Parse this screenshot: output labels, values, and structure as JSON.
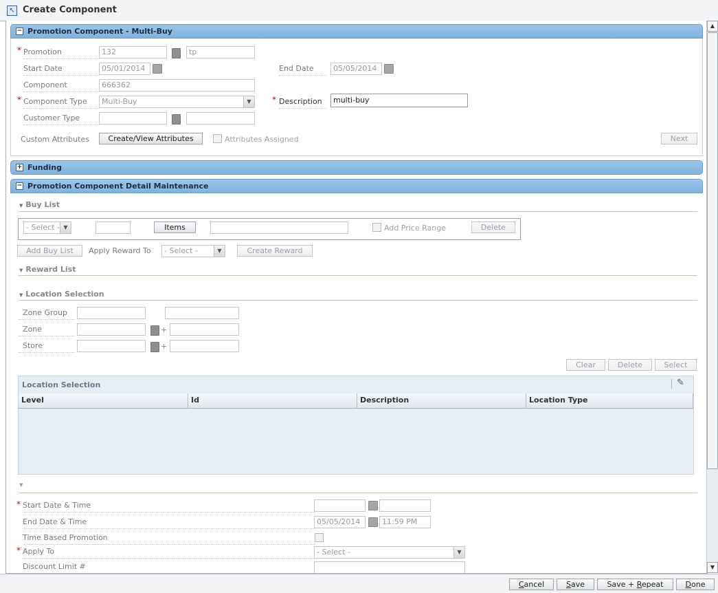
{
  "window": {
    "title": "Create Component"
  },
  "section_main": {
    "title": "Promotion Component - Multi-Buy",
    "promotion_label": "Promotion",
    "promotion_id": "132",
    "promotion_desc": "tp",
    "start_date_label": "Start Date",
    "start_date": "05/01/2014",
    "end_date_label": "End Date",
    "end_date": "05/05/2014",
    "component_label": "Component",
    "component": "666362",
    "component_type_label": "Component Type",
    "component_type": "Multi-Buy",
    "description_label": "Description",
    "description": "multi-buy",
    "customer_type_label": "Customer Type",
    "custom_attributes_label": "Custom Attributes",
    "create_view_attributes": "Create/View Attributes",
    "attributes_assigned": "Attributes Assigned",
    "next": "Next"
  },
  "section_funding": {
    "title": "Funding"
  },
  "section_detail": {
    "title": "Promotion Component Detail Maintenance",
    "buy_list": {
      "title": "Buy List",
      "select_placeholder": "- Select -",
      "items": "Items",
      "add_price_range": "Add Price Range",
      "delete": "Delete",
      "add_buy_list": "Add Buy List",
      "apply_reward_to_label": "Apply Reward To",
      "apply_reward_select": "- Select -",
      "create_reward": "Create Reward"
    },
    "reward_list": {
      "title": "Reward List"
    },
    "location_selection": {
      "title": "Location Selection",
      "zone_group_label": "Zone Group",
      "zone_label": "Zone",
      "store_label": "Store",
      "plus": "+",
      "clear": "Clear",
      "delete": "Delete",
      "select": "Select",
      "table_title": "Location Selection",
      "columns": [
        "Level",
        "Id",
        "Description",
        "Location Type"
      ]
    },
    "dates": {
      "start_label": "Start Date & Time",
      "end_label": "End Date & Time",
      "end_date": "05/05/2014",
      "end_time": "11:59 PM",
      "time_based_label": "Time Based Promotion",
      "apply_to_label": "Apply To",
      "apply_to_select": "- Select -",
      "discount_limit_label": "Discount Limit #"
    }
  },
  "footer": {
    "cancel_pre": "",
    "cancel_u": "C",
    "cancel_post": "ancel",
    "save_pre": "",
    "save_u": "S",
    "save_post": "ave",
    "save_repeat_pre": "Save + ",
    "save_repeat_u": "R",
    "save_repeat_post": "epeat",
    "done_pre": "",
    "done_u": "D",
    "done_post": "one"
  },
  "required_mark": "*",
  "icons": {
    "expand": "+",
    "collapse": "−",
    "triangle": "▼",
    "up": "▲",
    "down": "▼"
  }
}
